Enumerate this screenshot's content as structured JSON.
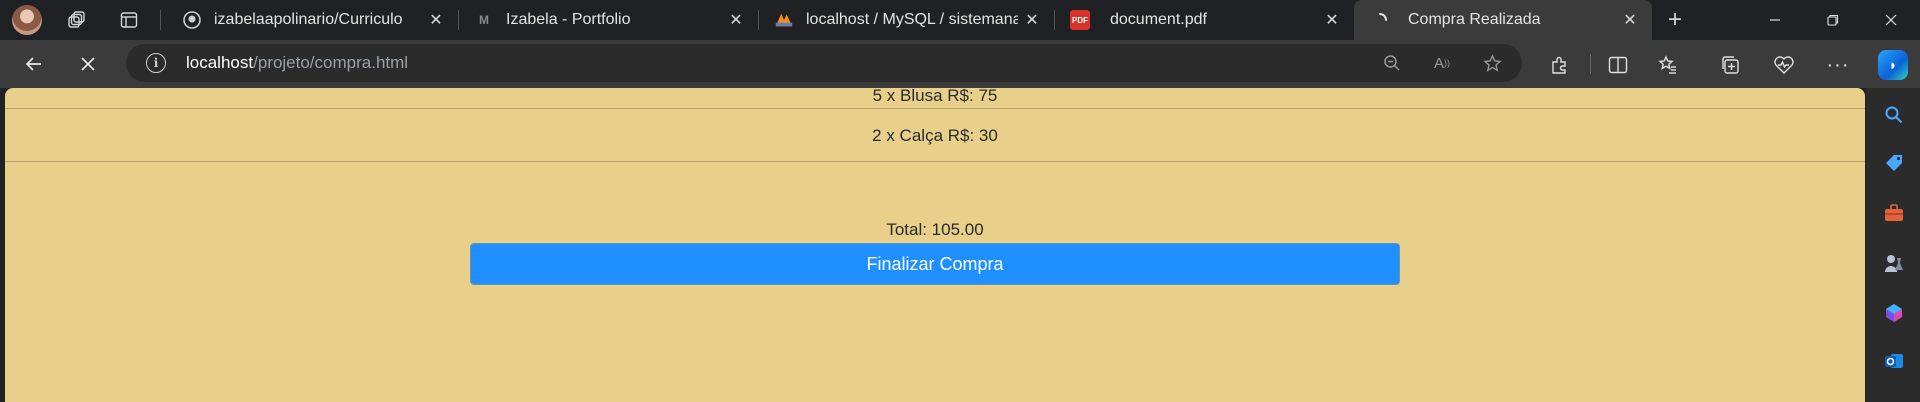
{
  "browser": {
    "tabs": [
      {
        "title": "izabelaapolinario/Curriculo",
        "favicon": "github-icon"
      },
      {
        "title": "Izabela - Portfolio",
        "favicon": "portfolio-icon"
      },
      {
        "title": "localhost / MySQL / sistemanacj",
        "favicon": "phpmyadmin-icon"
      },
      {
        "title": "document.pdf",
        "favicon": "pdf-icon"
      },
      {
        "title": "Compra Realizada",
        "favicon": "loading-icon",
        "active": true
      }
    ],
    "address": {
      "host": "localhost",
      "path": "/projeto/compra.html"
    }
  },
  "page": {
    "background": "#e8d08a",
    "items": [
      {
        "text": "5 x Blusa R$: 75"
      },
      {
        "text": "2 x Calça R$: 30"
      }
    ],
    "total_text": "Total: 105.00",
    "finalize_label": "Finalizar Compra",
    "finalize_color": "#1e90ff"
  }
}
